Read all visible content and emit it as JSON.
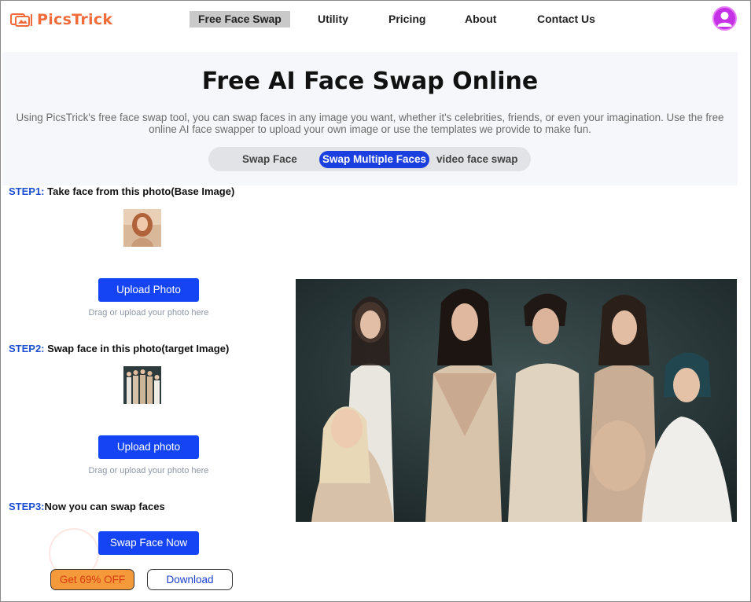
{
  "brand": {
    "name": "PicsTrick",
    "color": "#f26b3a"
  },
  "nav": {
    "items": [
      {
        "label": "Free Face Swap",
        "active": true
      },
      {
        "label": "Utility"
      },
      {
        "label": "Pricing"
      },
      {
        "label": "About"
      },
      {
        "label": "Contact Us"
      }
    ],
    "avatar_icon": "user-icon"
  },
  "hero": {
    "title": "Free AI Face Swap Online",
    "description": "Using PicsTrick's free face swap tool, you can swap faces in any image you want, whether it's celebrities, friends, or even your imagination. Use the free online AI face swapper to upload your own image or use the templates we provide to make fun.",
    "tabs": [
      {
        "label": "Swap Face"
      },
      {
        "label": "Swap Multiple Faces",
        "active": true
      },
      {
        "label": "video face swap"
      }
    ]
  },
  "steps": [
    {
      "number": "STEP1:",
      "text": "Take face from this photo(Base Image)",
      "button": "Upload Photo",
      "hint": "Drag or upload your photo here"
    },
    {
      "number": "STEP2:",
      "text": "Swap face in this photo(target Image)",
      "button": "Upload photo",
      "hint": "Drag or upload your photo here"
    },
    {
      "number": "STEP3:",
      "text": "Now you can swap faces",
      "button": "Swap Face Now"
    }
  ],
  "actions": {
    "offer": "Get 69% OFF",
    "download": "Download"
  },
  "colors": {
    "accent_blue": "#1544f5",
    "offer_orange": "#f59a3a",
    "step_blue": "#1c4fd0"
  }
}
